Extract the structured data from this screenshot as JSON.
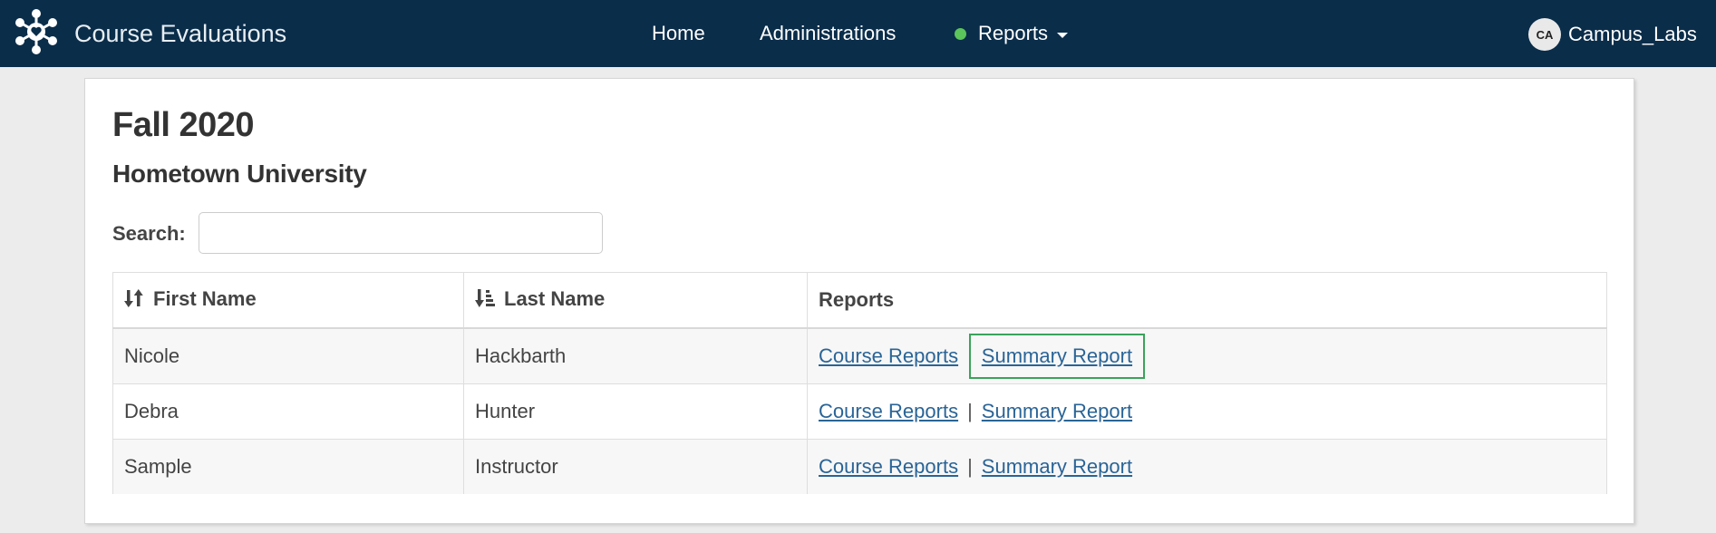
{
  "app": {
    "title": "Course Evaluations"
  },
  "nav": {
    "home": "Home",
    "administrations": "Administrations",
    "reports": "Reports",
    "reports_status_color": "#5bc45a"
  },
  "user": {
    "initials": "CA",
    "name": "Campus_Labs"
  },
  "page": {
    "title": "Fall 2020",
    "subtitle": "Hometown University",
    "search_label": "Search:",
    "search_value": ""
  },
  "table": {
    "headers": {
      "first_name": "First Name",
      "last_name": "Last Name",
      "reports": "Reports"
    },
    "separator": "|",
    "rows": [
      {
        "first": "Nicole",
        "last": "Hackbarth",
        "course_link": "Course Reports",
        "summary_link": "Summary Report"
      },
      {
        "first": "Debra",
        "last": "Hunter",
        "course_link": "Course Reports",
        "summary_link": "Summary Report"
      },
      {
        "first": "Sample",
        "last": "Instructor",
        "course_link": "Course Reports",
        "summary_link": "Summary Report"
      }
    ]
  },
  "icons": {
    "brand": "network-heart-logo-icon",
    "sort_first": "sort-both-icon",
    "sort_last": "sort-ascending-icon",
    "reports_dot": "status-dot-icon",
    "reports_caret": "caret-down-icon"
  },
  "colors": {
    "navbar": "#0a2d4a",
    "link": "#2a6496",
    "highlight": "#3aa35a"
  }
}
